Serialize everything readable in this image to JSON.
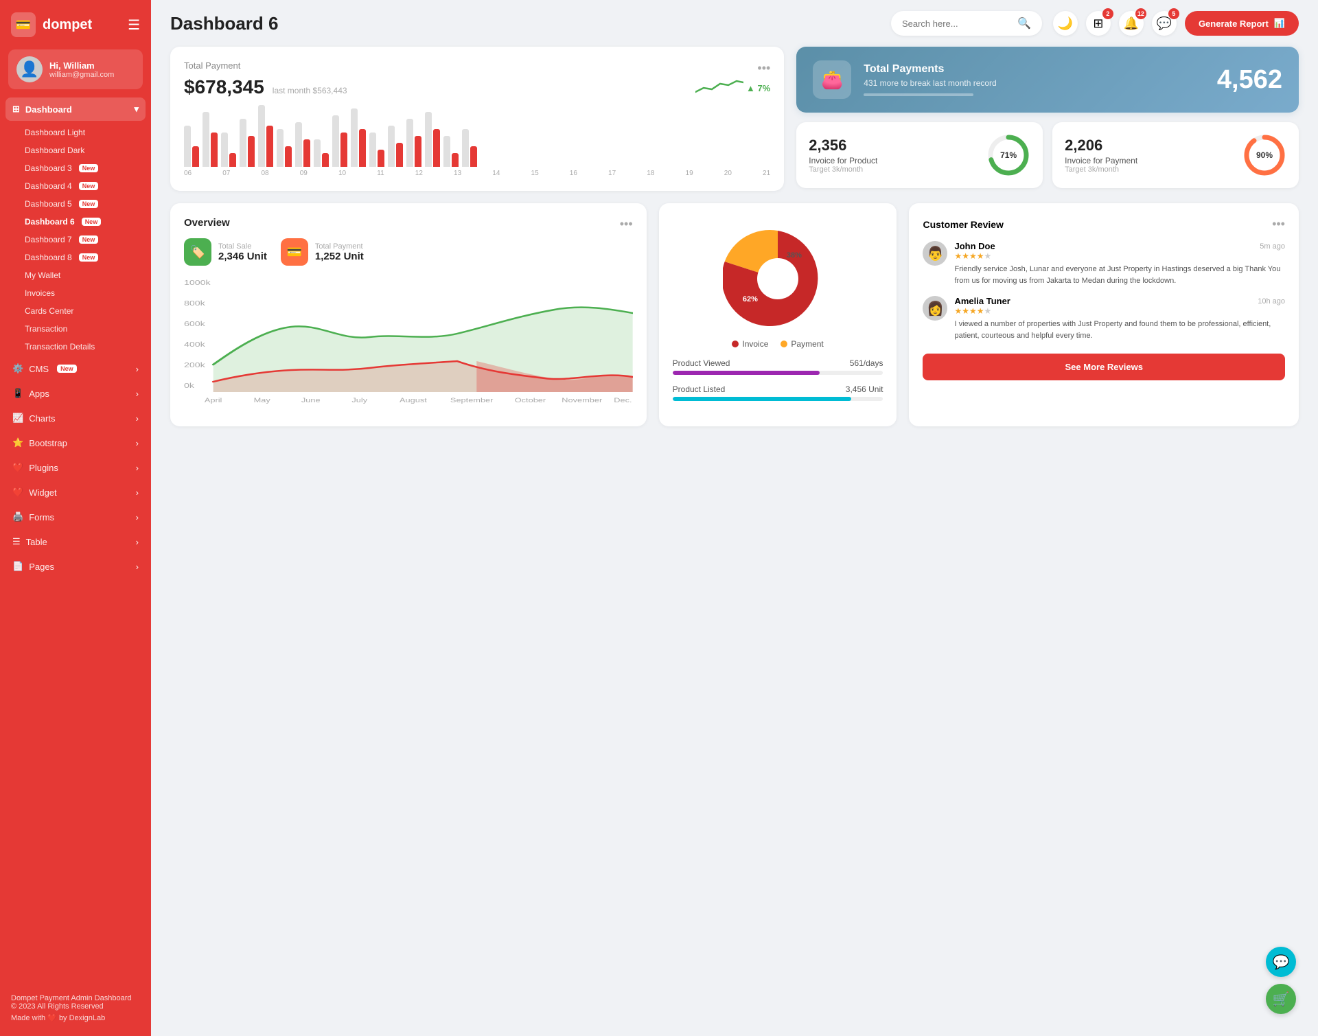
{
  "sidebar": {
    "logo": "dompet",
    "logo_icon": "💳",
    "hamburger": "☰",
    "user": {
      "name": "Hi, William",
      "email": "william@gmail.com",
      "avatar": "👤"
    },
    "dashboard_label": "Dashboard",
    "dashboard_items": [
      {
        "label": "Dashboard Light",
        "active": false,
        "badge": ""
      },
      {
        "label": "Dashboard Dark",
        "active": false,
        "badge": ""
      },
      {
        "label": "Dashboard 3",
        "active": false,
        "badge": "New"
      },
      {
        "label": "Dashboard 4",
        "active": false,
        "badge": "New"
      },
      {
        "label": "Dashboard 5",
        "active": false,
        "badge": "New"
      },
      {
        "label": "Dashboard 6",
        "active": true,
        "badge": "New"
      },
      {
        "label": "Dashboard 7",
        "active": false,
        "badge": "New"
      },
      {
        "label": "Dashboard 8",
        "active": false,
        "badge": "New"
      },
      {
        "label": "My Wallet",
        "active": false,
        "badge": ""
      },
      {
        "label": "Invoices",
        "active": false,
        "badge": ""
      },
      {
        "label": "Cards Center",
        "active": false,
        "badge": ""
      },
      {
        "label": "Transaction",
        "active": false,
        "badge": ""
      },
      {
        "label": "Transaction Details",
        "active": false,
        "badge": ""
      }
    ],
    "nav_items": [
      {
        "label": "CMS",
        "icon": "⚙️",
        "badge": "New",
        "arrow": "›"
      },
      {
        "label": "Apps",
        "icon": "📱",
        "badge": "",
        "arrow": "›"
      },
      {
        "label": "Charts",
        "icon": "📈",
        "badge": "",
        "arrow": "›"
      },
      {
        "label": "Bootstrap",
        "icon": "⭐",
        "badge": "",
        "arrow": "›"
      },
      {
        "label": "Plugins",
        "icon": "❤️",
        "badge": "",
        "arrow": "›"
      },
      {
        "label": "Widget",
        "icon": "❤️",
        "badge": "",
        "arrow": "›"
      },
      {
        "label": "Forms",
        "icon": "🖨️",
        "badge": "",
        "arrow": "›"
      },
      {
        "label": "Table",
        "icon": "☰",
        "badge": "",
        "arrow": "›"
      },
      {
        "label": "Pages",
        "icon": "📄",
        "badge": "",
        "arrow": "›"
      }
    ],
    "footer": {
      "line1": "Dompet Payment Admin Dashboard",
      "line2": "© 2023 All Rights Reserved",
      "made_with": "Made with ❤️ by DexignLab"
    }
  },
  "header": {
    "title": "Dashboard 6",
    "search_placeholder": "Search here...",
    "theme_icon": "🌙",
    "grid_badge": "2",
    "bell_badge": "12",
    "chat_badge": "5",
    "generate_btn": "Generate Report"
  },
  "total_payment": {
    "title": "Total Payment",
    "amount": "$678,345",
    "last_month": "last month $563,443",
    "trend": "7%",
    "bar_labels": [
      "06",
      "07",
      "08",
      "09",
      "10",
      "11",
      "12",
      "13",
      "14",
      "15",
      "16",
      "17",
      "18",
      "19",
      "20",
      "21"
    ],
    "bars_gray": [
      60,
      80,
      50,
      70,
      90,
      55,
      65,
      40,
      75,
      85,
      50,
      60,
      70,
      80,
      45,
      55
    ],
    "bars_red": [
      30,
      50,
      20,
      45,
      60,
      30,
      40,
      20,
      50,
      55,
      25,
      35,
      45,
      55,
      20,
      30
    ]
  },
  "total_payments_blue": {
    "title": "Total Payments",
    "sub": "431 more to break last month record",
    "number": "4,562",
    "icon": "👛"
  },
  "invoice_product": {
    "amount": "2,356",
    "label": "Invoice for Product",
    "target": "Target 3k/month",
    "percent": 71,
    "color": "#4caf50"
  },
  "invoice_payment": {
    "amount": "2,206",
    "label": "Invoice for Payment",
    "target": "Target 3k/month",
    "percent": 90,
    "color": "#ff7043"
  },
  "overview": {
    "title": "Overview",
    "total_sale_label": "Total Sale",
    "total_sale_value": "2,346 Unit",
    "total_payment_label": "Total Payment",
    "total_payment_value": "1,252 Unit",
    "months": [
      "April",
      "May",
      "June",
      "July",
      "August",
      "September",
      "October",
      "November",
      "Dec."
    ],
    "y_labels": [
      "1000k",
      "800k",
      "600k",
      "400k",
      "200k",
      "0k"
    ]
  },
  "pie": {
    "invoice_pct": 62,
    "payment_pct": 38,
    "invoice_label": "Invoice",
    "payment_label": "Payment",
    "invoice_color": "#c62828",
    "payment_color": "#ffa726"
  },
  "product_viewed": {
    "label": "Product Viewed",
    "value": "561/days",
    "color": "#9c27b0",
    "pct": 70
  },
  "product_listed": {
    "label": "Product Listed",
    "value": "3,456 Unit",
    "color": "#00bcd4",
    "pct": 85
  },
  "customer_review": {
    "title": "Customer Review",
    "reviews": [
      {
        "name": "John Doe",
        "time": "5m ago",
        "stars": 4,
        "text": "Friendly service Josh, Lunar and everyone at Just Property in Hastings deserved a big Thank You from us for moving us from Jakarta to Medan during the lockdown.",
        "avatar": "👨"
      },
      {
        "name": "Amelia Tuner",
        "time": "10h ago",
        "stars": 4,
        "text": "I viewed a number of properties with Just Property and found them to be professional, efficient, patient, courteous and helpful every time.",
        "avatar": "👩"
      }
    ],
    "see_more_btn": "See More Reviews"
  },
  "fab": {
    "chat_icon": "💬",
    "cart_icon": "🛒"
  }
}
